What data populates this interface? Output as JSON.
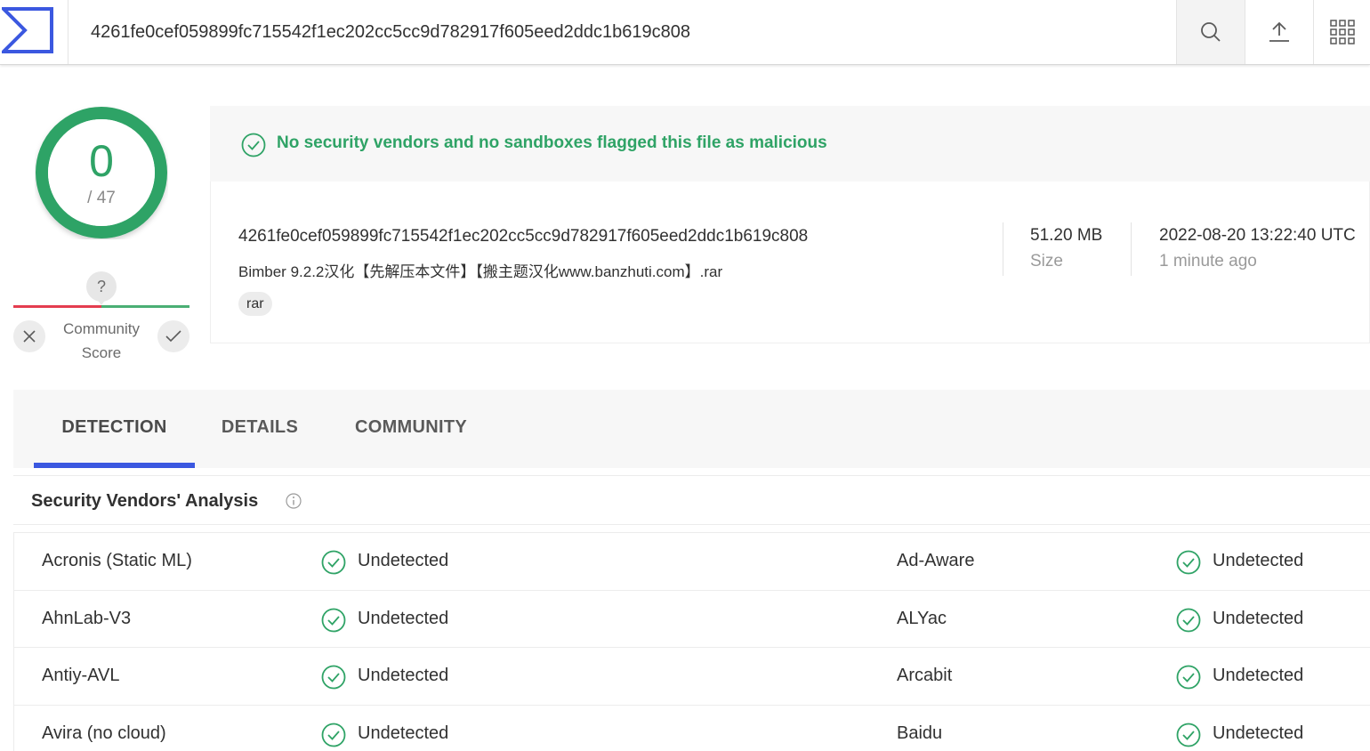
{
  "header": {
    "search_value": "4261fe0cef059899fc715542f1ec202cc5cc9d782917f605eed2ddc1b619c808"
  },
  "score": {
    "detections": "0",
    "total": "/ 47",
    "community_question": "?",
    "community_label_1": "Community",
    "community_label_2": "Score"
  },
  "banner": {
    "message": "No security vendors and no sandboxes flagged this file as malicious"
  },
  "file": {
    "hash": "4261fe0cef059899fc715542f1ec202cc5cc9d782917f605eed2ddc1b619c808",
    "name": "Bimber 9.2.2汉化【先解压本文件】【搬主题汉化www.banzhuti.com】.rar",
    "tag": "rar",
    "size_value": "51.20 MB",
    "size_label": "Size",
    "date_value": "2022-08-20 13:22:40 UTC",
    "date_label": "1 minute ago"
  },
  "tabs": {
    "detection": "DETECTION",
    "details": "DETAILS",
    "community": "COMMUNITY"
  },
  "vendors": {
    "title": "Security Vendors' Analysis",
    "rows": [
      {
        "left_name": "Acronis (Static ML)",
        "left_result": "Undetected",
        "right_name": "Ad-Aware",
        "right_result": "Undetected"
      },
      {
        "left_name": "AhnLab-V3",
        "left_result": "Undetected",
        "right_name": "ALYac",
        "right_result": "Undetected"
      },
      {
        "left_name": "Antiy-AVL",
        "left_result": "Undetected",
        "right_name": "Arcabit",
        "right_result": "Undetected"
      },
      {
        "left_name": "Avira (no cloud)",
        "left_result": "Undetected",
        "right_name": "Baidu",
        "right_result": "Undetected"
      }
    ]
  },
  "colors": {
    "clean_green": "#2fa366",
    "accent_blue": "#3b58e0",
    "negative_red": "#e43d4f"
  }
}
